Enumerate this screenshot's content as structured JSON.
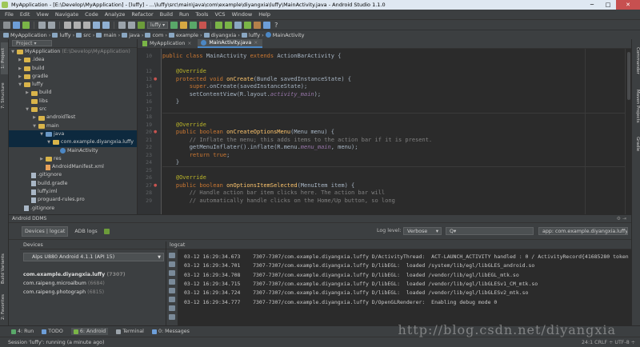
{
  "window": {
    "title": "MyApplication - [E:\\Develop\\MyApplication] - [luffy] - ...\\luffy\\src\\main\\java\\com\\example\\diyangxia\\luffy\\MainActivity.java - Android Studio 1.1.0",
    "min": "─",
    "max": "□",
    "close": "✕"
  },
  "menu": [
    "File",
    "Edit",
    "View",
    "Navigate",
    "Code",
    "Analyze",
    "Refactor",
    "Build",
    "Run",
    "Tools",
    "VCS",
    "Window",
    "Help"
  ],
  "toolbar": {
    "run_config": "luffy",
    "help": "?"
  },
  "breadcrumb": [
    "MyApplication",
    "luffy",
    "src",
    "main",
    "java",
    "com",
    "example",
    "diyangxia",
    "luffy",
    "MainActivity"
  ],
  "project_panel": {
    "combo": "Project",
    "tree": [
      {
        "label": "MyApplication",
        "extra": " (E:\\Develop\\MyApplication)",
        "depth": 0,
        "arrow": "▼",
        "icon": "folder"
      },
      {
        "label": ".idea",
        "depth": 1,
        "arrow": "▶",
        "icon": "folder"
      },
      {
        "label": "build",
        "depth": 1,
        "arrow": "▶",
        "icon": "folder"
      },
      {
        "label": "gradle",
        "depth": 1,
        "arrow": "▶",
        "icon": "folder"
      },
      {
        "label": "luffy",
        "depth": 1,
        "arrow": "▼",
        "icon": "folder"
      },
      {
        "label": "build",
        "depth": 2,
        "arrow": "▶",
        "icon": "folder"
      },
      {
        "label": "libs",
        "depth": 2,
        "arrow": "",
        "icon": "folder"
      },
      {
        "label": "src",
        "depth": 2,
        "arrow": "▼",
        "icon": "folder"
      },
      {
        "label": "androidTest",
        "depth": 3,
        "arrow": "▶",
        "icon": "folder"
      },
      {
        "label": "main",
        "depth": 3,
        "arrow": "▼",
        "icon": "folder"
      },
      {
        "label": "java",
        "depth": 4,
        "arrow": "▼",
        "icon": "folder-blue",
        "sel": "sel"
      },
      {
        "label": "com.example.diyangxia.luffy",
        "depth": 5,
        "arrow": "▼",
        "icon": "folder",
        "sel": "sel"
      },
      {
        "label": "MainActivity",
        "depth": 6,
        "arrow": "",
        "icon": "class"
      },
      {
        "label": "res",
        "depth": 4,
        "arrow": "▶",
        "icon": "folder"
      },
      {
        "label": "AndroidManifest.xml",
        "depth": 4,
        "arrow": "",
        "icon": "xml"
      },
      {
        "label": ".gitignore",
        "depth": 2,
        "arrow": "",
        "icon": "file"
      },
      {
        "label": "build.gradle",
        "depth": 2,
        "arrow": "",
        "icon": "file"
      },
      {
        "label": "luffy.iml",
        "depth": 2,
        "arrow": "",
        "icon": "file"
      },
      {
        "label": "proguard-rules.pro",
        "depth": 2,
        "arrow": "",
        "icon": "file"
      },
      {
        "label": ".gitignore",
        "depth": 1,
        "arrow": "",
        "icon": "file"
      }
    ]
  },
  "left_strip": {
    "project": "1: Project",
    "structure": "7: Structure",
    "build_variants": "Build Variants",
    "favorites": "2: Favorites"
  },
  "right_strip": {
    "commander": "Commander",
    "maven": "Maven Projects",
    "gradle": "Gradle"
  },
  "editor": {
    "tabs": [
      {
        "label": "MyApplication",
        "active": false
      },
      {
        "label": "MainActivity.java",
        "active": true
      }
    ],
    "line_numbers": [
      "10",
      "",
      "12",
      "13",
      "14",
      "15",
      "16",
      "17",
      "18",
      "19",
      "20",
      "21",
      "22",
      "23",
      "24",
      "25",
      "26",
      "27",
      "28",
      "29"
    ],
    "code_lines": [
      [
        [
          "kw",
          "public class "
        ],
        [
          "",
          "MainActivity "
        ],
        [
          "kw",
          "extends "
        ],
        [
          "",
          "ActionBarActivity {"
        ]
      ],
      [
        [
          "",
          ""
        ]
      ],
      [
        [
          "an",
          "    @Override"
        ]
      ],
      [
        [
          "kw",
          "    protected void "
        ],
        [
          "fn",
          "onCreate"
        ],
        [
          "",
          "(Bundle savedInstanceState) {"
        ]
      ],
      [
        [
          "kw",
          "        super"
        ],
        [
          "",
          ".onCreate(savedInstanceState);"
        ]
      ],
      [
        [
          "",
          "        setContentView(R.layout."
        ],
        [
          "it",
          "activity_main"
        ],
        [
          "",
          ");"
        ]
      ],
      [
        [
          "",
          "    }"
        ]
      ],
      [
        [
          "",
          ""
        ]
      ],
      [
        [
          "",
          ""
        ]
      ],
      [
        [
          "an",
          "    @Override"
        ]
      ],
      [
        [
          "kw",
          "    public boolean "
        ],
        [
          "fn",
          "onCreateOptionsMenu"
        ],
        [
          "",
          "(Menu menu) {"
        ]
      ],
      [
        [
          "cm",
          "        // Inflate the menu; this adds items to the action bar if it is present."
        ]
      ],
      [
        [
          "",
          "        getMenuInflater().inflate(R.menu."
        ],
        [
          "it",
          "menu_main"
        ],
        [
          "",
          ", menu);"
        ]
      ],
      [
        [
          "kw",
          "        return true"
        ],
        [
          "",
          ";"
        ]
      ],
      [
        [
          "",
          "    }"
        ]
      ],
      [
        [
          "",
          ""
        ]
      ],
      [
        [
          "an",
          "    @Override"
        ]
      ],
      [
        [
          "kw",
          "    public boolean "
        ],
        [
          "fn",
          "onOptionsItemSelected"
        ],
        [
          "",
          "(MenuItem item) {"
        ]
      ],
      [
        [
          "cm",
          "        // Handle action bar item clicks here. The action bar will"
        ]
      ],
      [
        [
          "cm",
          "        // automatically handle clicks on the Home/Up button, so long"
        ]
      ]
    ]
  },
  "ddms": {
    "title": "Android DDMS",
    "controls": "⚙ ⇥",
    "tabs": [
      "Devices | logcat",
      "ADB logs"
    ],
    "log_level_label": "Log level:",
    "log_level": "Verbose",
    "search_placeholder": "Q▾",
    "app_filter": "app: com.example.diyangxia.luffy",
    "devices_header": "Devices",
    "device": "Alps U880  Android 4.1.1 (API 15)",
    "processes": [
      {
        "name": "com.example.diyangxia.luffy",
        "pid": " (7307)"
      },
      {
        "name": "com.raipeng.microalbum",
        "pid": " (6684)"
      },
      {
        "name": "com.raipeng.photograph",
        "pid": " (6815)"
      }
    ],
    "logcat_header": "logcat",
    "log_lines": [
      "03-12 16:29:34.673    7307-7307/com.example.diyangxia.luffy D/ActivityThread:  ACT-LAUNCH_ACTIVITY handled : 0 / ActivityRecord{41685280 token",
      "03-12 16:29:34.701    7307-7307/com.example.diyangxia.luffy D/libEGL:  loaded /system/lib/egl/libGLES_android.so",
      "03-12 16:29:34.708    7307-7307/com.example.diyangxia.luffy D/libEGL:  loaded /vendor/lib/egl/libEGL_mtk.so",
      "03-12 16:29:34.715    7307-7307/com.example.diyangxia.luffy D/libEGL:  loaded /vendor/lib/egl/libGLESv1_CM_mtk.so",
      "03-12 16:29:34.724    7307-7307/com.example.diyangxia.luffy D/libEGL:  loaded /vendor/lib/egl/libGLESv2_mtk.so",
      "03-12 16:29:34.777    7307-7307/com.example.diyangxia.luffy D/OpenGLRenderer:  Enabling debug mode 0"
    ]
  },
  "bottom_tabs": [
    "4: Run",
    "TODO",
    "6: Android",
    "Terminal",
    "0: Messages"
  ],
  "status": {
    "text": "Session 'luffy': running (a minute ago)",
    "right": "24:1   CRLF ÷   UTF-8 ÷"
  },
  "watermark": "http://blog.csdn.net/diyangxia",
  "colors": {
    "accent": "#4a88c7",
    "background": "#2b2b2b",
    "panel": "#3c3f41"
  }
}
